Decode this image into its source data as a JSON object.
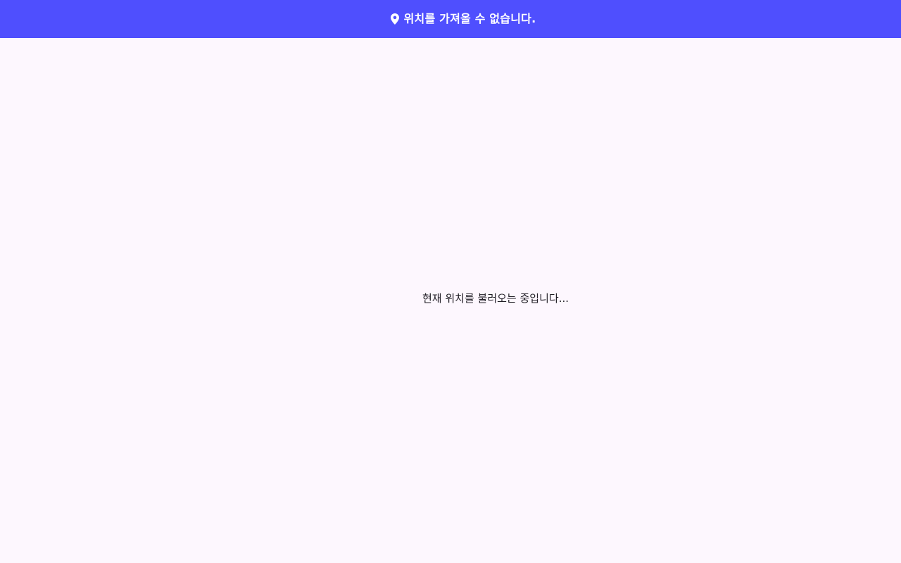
{
  "banner": {
    "icon": "location-pin-icon",
    "message": "위치를 가져올 수 없습니다.",
    "background_color": "#4f4ffe",
    "text_color": "#ffffff"
  },
  "main": {
    "loading_message": "현재 위치를 불러오는 중입니다...",
    "background_color": "#fdf7fe"
  }
}
